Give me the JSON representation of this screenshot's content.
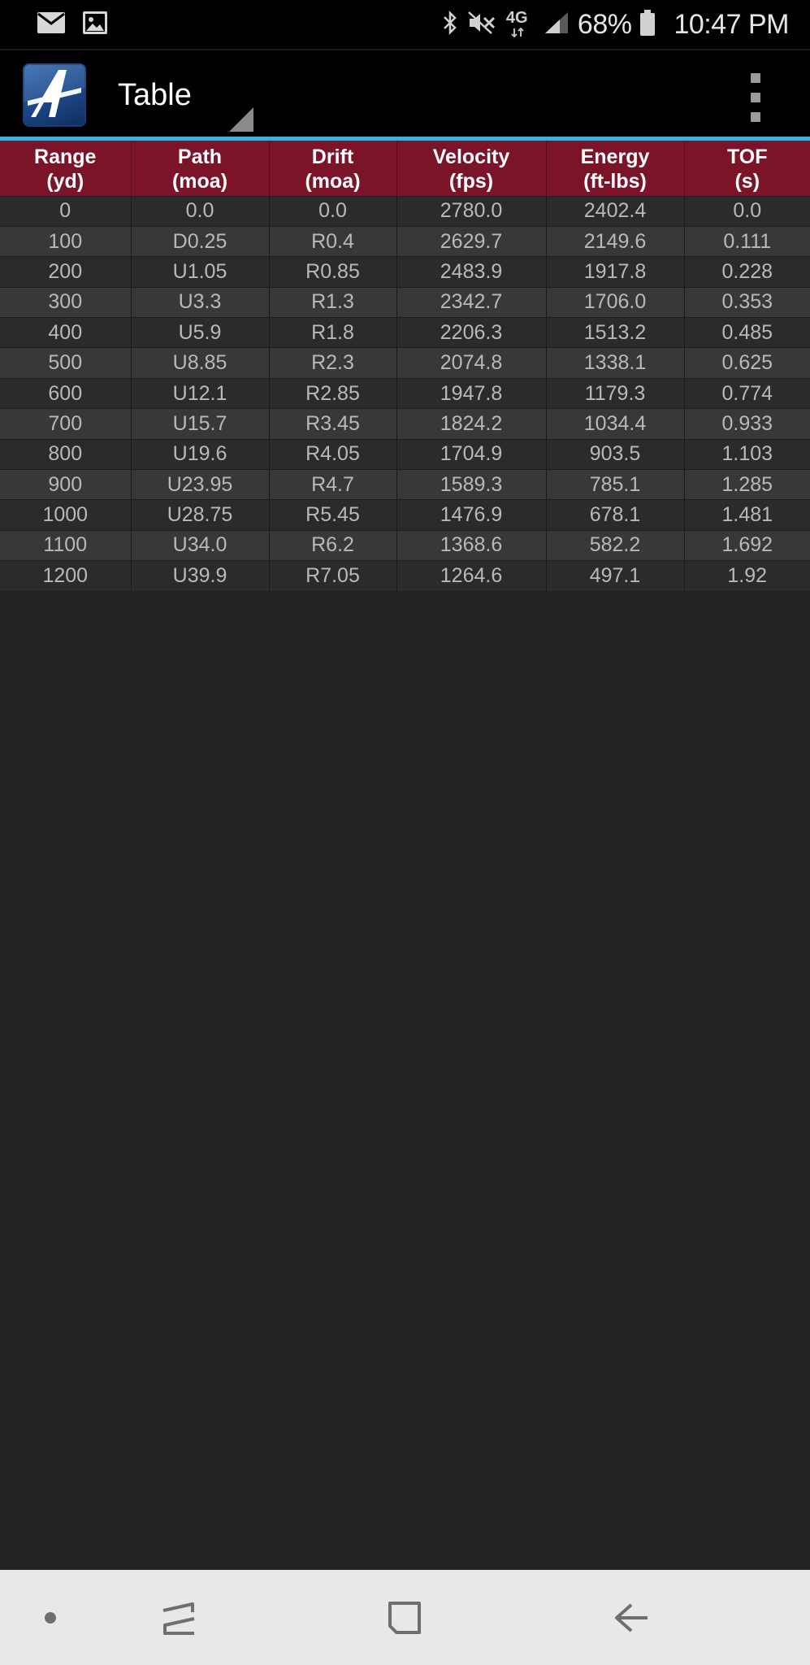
{
  "status_bar": {
    "battery_percent": "68%",
    "time": "10:47 PM",
    "network_label": "4G",
    "icons": [
      "mail-icon",
      "image-icon",
      "bluetooth-icon",
      "mute-icon",
      "lte-icon",
      "signal-icon",
      "battery-icon"
    ]
  },
  "app_bar": {
    "title": "Table",
    "logo_icon": "app-logo-icon",
    "menu_icon": "overflow-menu-icon"
  },
  "colors": {
    "header_bg": "#7b1429",
    "accent": "#33b5e5",
    "row_odd": "#2b2b2b",
    "row_even": "#383838",
    "background": "#222222"
  },
  "table": {
    "columns": [
      {
        "line1": "Range",
        "line2": "(yd)"
      },
      {
        "line1": "Path",
        "line2": "(moa)"
      },
      {
        "line1": "Drift",
        "line2": "(moa)"
      },
      {
        "line1": "Velocity",
        "line2": "(fps)"
      },
      {
        "line1": "Energy",
        "line2": "(ft-lbs)"
      },
      {
        "line1": "TOF",
        "line2": "(s)"
      }
    ],
    "rows": [
      [
        "0",
        "0.0",
        "0.0",
        "2780.0",
        "2402.4",
        "0.0"
      ],
      [
        "100",
        "D0.25",
        "R0.4",
        "2629.7",
        "2149.6",
        "0.111"
      ],
      [
        "200",
        "U1.05",
        "R0.85",
        "2483.9",
        "1917.8",
        "0.228"
      ],
      [
        "300",
        "U3.3",
        "R1.3",
        "2342.7",
        "1706.0",
        "0.353"
      ],
      [
        "400",
        "U5.9",
        "R1.8",
        "2206.3",
        "1513.2",
        "0.485"
      ],
      [
        "500",
        "U8.85",
        "R2.3",
        "2074.8",
        "1338.1",
        "0.625"
      ],
      [
        "600",
        "U12.1",
        "R2.85",
        "1947.8",
        "1179.3",
        "0.774"
      ],
      [
        "700",
        "U15.7",
        "R3.45",
        "1824.2",
        "1034.4",
        "0.933"
      ],
      [
        "800",
        "U19.6",
        "R4.05",
        "1704.9",
        "903.5",
        "1.103"
      ],
      [
        "900",
        "U23.95",
        "R4.7",
        "1589.3",
        "785.1",
        "1.285"
      ],
      [
        "1000",
        "U28.75",
        "R5.45",
        "1476.9",
        "678.1",
        "1.481"
      ],
      [
        "1100",
        "U34.0",
        "R6.2",
        "1368.6",
        "582.2",
        "1.692"
      ],
      [
        "1200",
        "U39.9",
        "R7.05",
        "1264.6",
        "497.1",
        "1.92"
      ]
    ]
  },
  "nav_bar": {
    "buttons": [
      "dot-icon",
      "recents-icon",
      "home-icon",
      "back-icon"
    ]
  }
}
